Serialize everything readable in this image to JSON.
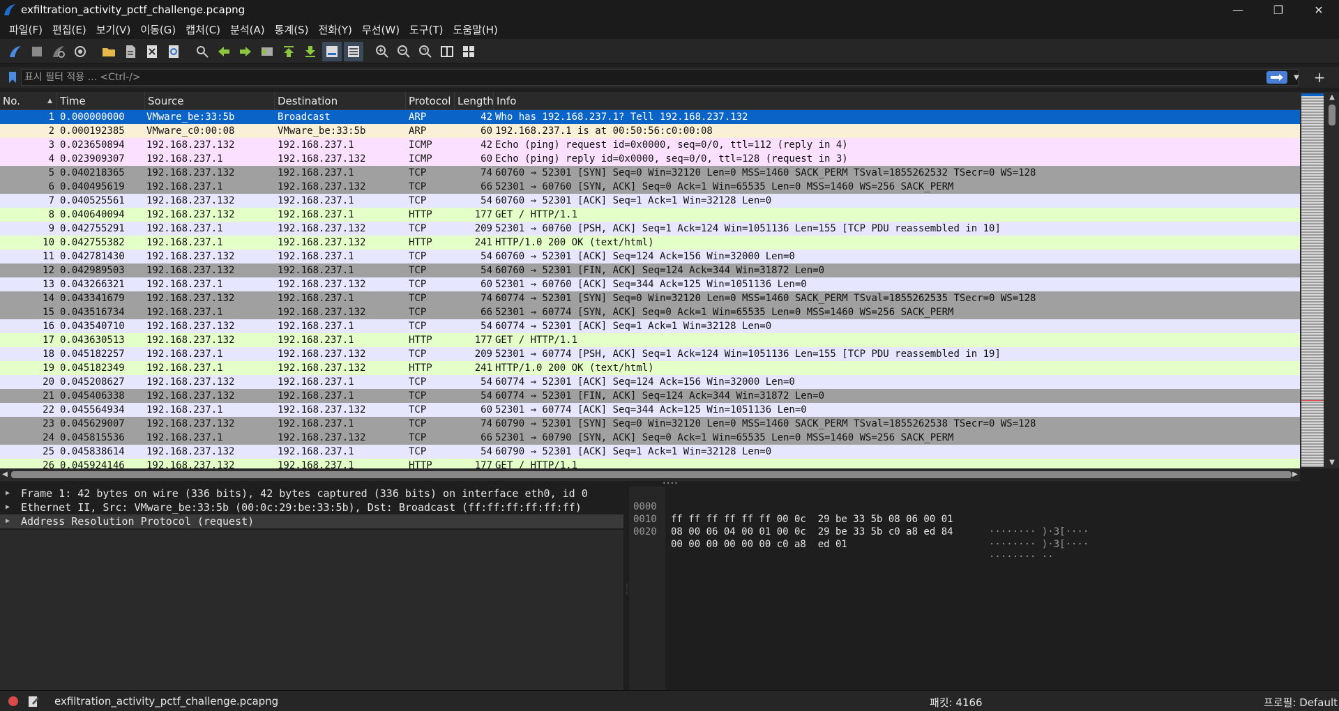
{
  "window": {
    "title": "exfiltration_activity_pctf_challenge.pcapng",
    "minimize": "—",
    "restore": "❐",
    "close": "✕"
  },
  "menu": [
    "파일(F)",
    "편집(E)",
    "보기(V)",
    "이동(G)",
    "캡처(C)",
    "분석(A)",
    "통계(S)",
    "전화(Y)",
    "무선(W)",
    "도구(T)",
    "도움말(H)"
  ],
  "filter": {
    "placeholder": "표시 필터 적용 ... <Ctrl-/>",
    "value": ""
  },
  "columns": {
    "no": "No.",
    "time": "Time",
    "source": "Source",
    "destination": "Destination",
    "protocol": "Protocol",
    "length": "Length",
    "info": "Info"
  },
  "colors": {
    "selected": "#0a64c8",
    "arp": "#faf0d7",
    "icmp": "#fce0ff",
    "tcp_flag": "#a0a0a0",
    "tcp": "#e7e6ff",
    "http": "#e4ffc7"
  },
  "packets": [
    {
      "no": "1",
      "time": "0.000000000",
      "source": "VMware_be:33:5b",
      "destination": "Broadcast",
      "protocol": "ARP",
      "length": "42",
      "info": "Who has 192.168.237.1? Tell 192.168.237.132",
      "style": "selected"
    },
    {
      "no": "2",
      "time": "0.000192385",
      "source": "VMware_c0:00:08",
      "destination": "VMware_be:33:5b",
      "protocol": "ARP",
      "length": "60",
      "info": "192.168.237.1 is at 00:50:56:c0:00:08",
      "style": "arp"
    },
    {
      "no": "3",
      "time": "0.023650894",
      "source": "192.168.237.132",
      "destination": "192.168.237.1",
      "protocol": "ICMP",
      "length": "42",
      "info": "Echo (ping) request  id=0x0000, seq=0/0, ttl=112 (reply in 4)",
      "style": "icmp"
    },
    {
      "no": "4",
      "time": "0.023909307",
      "source": "192.168.237.1",
      "destination": "192.168.237.132",
      "protocol": "ICMP",
      "length": "60",
      "info": "Echo (ping) reply    id=0x0000, seq=0/0, ttl=128 (request in 3)",
      "style": "icmp"
    },
    {
      "no": "5",
      "time": "0.040218365",
      "source": "192.168.237.132",
      "destination": "192.168.237.1",
      "protocol": "TCP",
      "length": "74",
      "info": "60760 → 52301 [SYN] Seq=0 Win=32120 Len=0 MSS=1460 SACK_PERM TSval=1855262532 TSecr=0 WS=128",
      "style": "tcp_flag"
    },
    {
      "no": "6",
      "time": "0.040495619",
      "source": "192.168.237.1",
      "destination": "192.168.237.132",
      "protocol": "TCP",
      "length": "66",
      "info": "52301 → 60760 [SYN, ACK] Seq=0 Ack=1 Win=65535 Len=0 MSS=1460 WS=256 SACK_PERM",
      "style": "tcp_flag"
    },
    {
      "no": "7",
      "time": "0.040525561",
      "source": "192.168.237.132",
      "destination": "192.168.237.1",
      "protocol": "TCP",
      "length": "54",
      "info": "60760 → 52301 [ACK] Seq=1 Ack=1 Win=32128 Len=0",
      "style": "tcp"
    },
    {
      "no": "8",
      "time": "0.040640094",
      "source": "192.168.237.132",
      "destination": "192.168.237.1",
      "protocol": "HTTP",
      "length": "177",
      "info": "GET / HTTP/1.1",
      "style": "http"
    },
    {
      "no": "9",
      "time": "0.042755291",
      "source": "192.168.237.1",
      "destination": "192.168.237.132",
      "protocol": "TCP",
      "length": "209",
      "info": "52301 → 60760 [PSH, ACK] Seq=1 Ack=124 Win=1051136 Len=155 [TCP PDU reassembled in 10]",
      "style": "tcp"
    },
    {
      "no": "10",
      "time": "0.042755382",
      "source": "192.168.237.1",
      "destination": "192.168.237.132",
      "protocol": "HTTP",
      "length": "241",
      "info": "HTTP/1.0 200 OK  (text/html)",
      "style": "http"
    },
    {
      "no": "11",
      "time": "0.042781430",
      "source": "192.168.237.132",
      "destination": "192.168.237.1",
      "protocol": "TCP",
      "length": "54",
      "info": "60760 → 52301 [ACK] Seq=124 Ack=156 Win=32000 Len=0",
      "style": "tcp"
    },
    {
      "no": "12",
      "time": "0.042989503",
      "source": "192.168.237.132",
      "destination": "192.168.237.1",
      "protocol": "TCP",
      "length": "54",
      "info": "60760 → 52301 [FIN, ACK] Seq=124 Ack=344 Win=31872 Len=0",
      "style": "tcp_flag"
    },
    {
      "no": "13",
      "time": "0.043266321",
      "source": "192.168.237.1",
      "destination": "192.168.237.132",
      "protocol": "TCP",
      "length": "60",
      "info": "52301 → 60760 [ACK] Seq=344 Ack=125 Win=1051136 Len=0",
      "style": "tcp"
    },
    {
      "no": "14",
      "time": "0.043341679",
      "source": "192.168.237.132",
      "destination": "192.168.237.1",
      "protocol": "TCP",
      "length": "74",
      "info": "60774 → 52301 [SYN] Seq=0 Win=32120 Len=0 MSS=1460 SACK_PERM TSval=1855262535 TSecr=0 WS=128",
      "style": "tcp_flag"
    },
    {
      "no": "15",
      "time": "0.043516734",
      "source": "192.168.237.1",
      "destination": "192.168.237.132",
      "protocol": "TCP",
      "length": "66",
      "info": "52301 → 60774 [SYN, ACK] Seq=0 Ack=1 Win=65535 Len=0 MSS=1460 WS=256 SACK_PERM",
      "style": "tcp_flag"
    },
    {
      "no": "16",
      "time": "0.043540710",
      "source": "192.168.237.132",
      "destination": "192.168.237.1",
      "protocol": "TCP",
      "length": "54",
      "info": "60774 → 52301 [ACK] Seq=1 Ack=1 Win=32128 Len=0",
      "style": "tcp"
    },
    {
      "no": "17",
      "time": "0.043630513",
      "source": "192.168.237.132",
      "destination": "192.168.237.1",
      "protocol": "HTTP",
      "length": "177",
      "info": "GET / HTTP/1.1",
      "style": "http"
    },
    {
      "no": "18",
      "time": "0.045182257",
      "source": "192.168.237.1",
      "destination": "192.168.237.132",
      "protocol": "TCP",
      "length": "209",
      "info": "52301 → 60774 [PSH, ACK] Seq=1 Ack=124 Win=1051136 Len=155 [TCP PDU reassembled in 19]",
      "style": "tcp"
    },
    {
      "no": "19",
      "time": "0.045182349",
      "source": "192.168.237.1",
      "destination": "192.168.237.132",
      "protocol": "HTTP",
      "length": "241",
      "info": "HTTP/1.0 200 OK  (text/html)",
      "style": "http"
    },
    {
      "no": "20",
      "time": "0.045208627",
      "source": "192.168.237.132",
      "destination": "192.168.237.1",
      "protocol": "TCP",
      "length": "54",
      "info": "60774 → 52301 [ACK] Seq=124 Ack=156 Win=32000 Len=0",
      "style": "tcp"
    },
    {
      "no": "21",
      "time": "0.045406338",
      "source": "192.168.237.132",
      "destination": "192.168.237.1",
      "protocol": "TCP",
      "length": "54",
      "info": "60774 → 52301 [FIN, ACK] Seq=124 Ack=344 Win=31872 Len=0",
      "style": "tcp_flag"
    },
    {
      "no": "22",
      "time": "0.045564934",
      "source": "192.168.237.1",
      "destination": "192.168.237.132",
      "protocol": "TCP",
      "length": "60",
      "info": "52301 → 60774 [ACK] Seq=344 Ack=125 Win=1051136 Len=0",
      "style": "tcp"
    },
    {
      "no": "23",
      "time": "0.045629007",
      "source": "192.168.237.132",
      "destination": "192.168.237.1",
      "protocol": "TCP",
      "length": "74",
      "info": "60790 → 52301 [SYN] Seq=0 Win=32120 Len=0 MSS=1460 SACK_PERM TSval=1855262538 TSecr=0 WS=128",
      "style": "tcp_flag"
    },
    {
      "no": "24",
      "time": "0.045815536",
      "source": "192.168.237.1",
      "destination": "192.168.237.132",
      "protocol": "TCP",
      "length": "66",
      "info": "52301 → 60790 [SYN, ACK] Seq=0 Ack=1 Win=65535 Len=0 MSS=1460 WS=256 SACK_PERM",
      "style": "tcp_flag"
    },
    {
      "no": "25",
      "time": "0.045838614",
      "source": "192.168.237.132",
      "destination": "192.168.237.1",
      "protocol": "TCP",
      "length": "54",
      "info": "60790 → 52301 [ACK] Seq=1 Ack=1 Win=32128 Len=0",
      "style": "tcp"
    },
    {
      "no": "26",
      "time": "0.045924146",
      "source": "192.168.237.132",
      "destination": "192.168.237.1",
      "protocol": "HTTP",
      "length": "177",
      "info": "GET / HTTP/1.1",
      "style": "http"
    }
  ],
  "details": [
    "Frame 1: 42 bytes on wire (336 bits), 42 bytes captured (336 bits) on interface eth0, id 0",
    "Ethernet II, Src: VMware_be:33:5b (00:0c:29:be:33:5b), Dst: Broadcast (ff:ff:ff:ff:ff:ff)",
    "Address Resolution Protocol (request)"
  ],
  "bytes": [
    {
      "offset": "0000",
      "hex": "ff ff ff ff ff ff 00 0c  29 be 33 5b 08 06 00 01",
      "ascii": "········ )·3[····"
    },
    {
      "offset": "0010",
      "hex": "08 00 06 04 00 01 00 0c  29 be 33 5b c0 a8 ed 84",
      "ascii": "········ )·3[····"
    },
    {
      "offset": "0020",
      "hex": "00 00 00 00 00 00 c0 a8  ed 01",
      "ascii": "········ ··"
    }
  ],
  "status": {
    "file": "exfiltration_activity_pctf_challenge.pcapng",
    "packets": "패킷: 4166",
    "profile": "프로필: Default"
  },
  "icons": {
    "app": "wireshark-fin-icon",
    "toolbar": [
      "start-capture-icon",
      "stop-capture-icon",
      "restart-capture-icon",
      "capture-options-icon",
      "open-file-icon",
      "save-file-icon",
      "close-file-icon",
      "reload-file-icon",
      "find-packet-icon",
      "go-back-icon",
      "go-forward-icon",
      "go-to-packet-icon",
      "go-first-icon",
      "go-last-icon",
      "autoscroll-icon",
      "colorize-icon",
      "zoom-in-icon",
      "zoom-out-icon",
      "zoom-normal-icon",
      "resize-columns-icon",
      "layout-icon"
    ]
  }
}
